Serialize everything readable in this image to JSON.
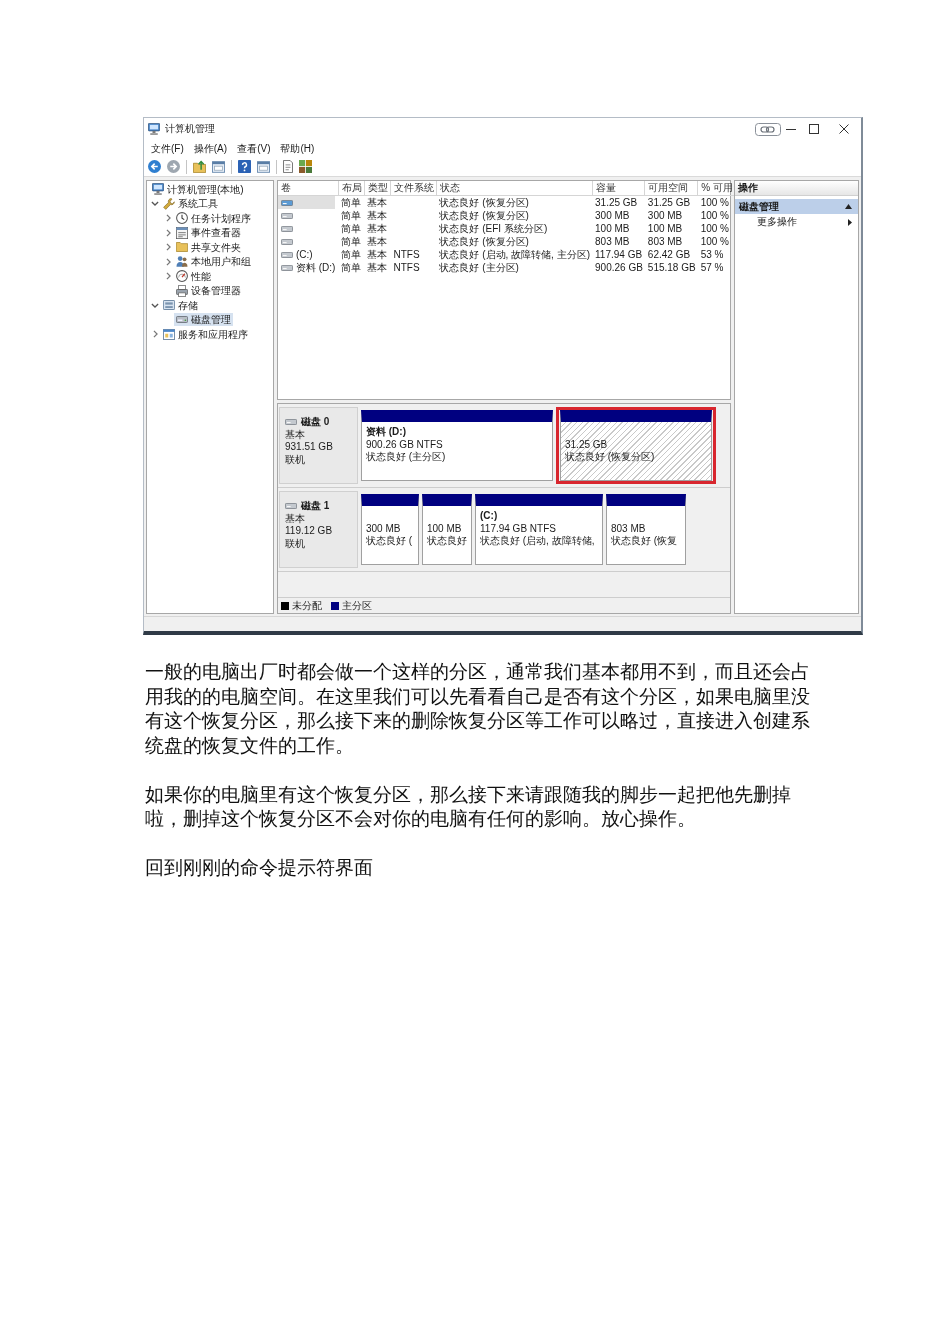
{
  "screenshot": {
    "window": {
      "title": "计算机管理"
    },
    "menu": [
      "文件(F)",
      "操作(A)",
      "查看(V)",
      "帮助(H)"
    ],
    "tree": [
      {
        "label": "计算机管理(本地)",
        "kind": "root",
        "selected": false,
        "children": [
          {
            "label": "系统工具",
            "kind": "branch",
            "expanded": true,
            "selected": false,
            "children": [
              {
                "label": "任务计划程序",
                "kind": "branch",
                "expanded": false,
                "selected": false
              },
              {
                "label": "事件查看器",
                "kind": "branch",
                "expanded": false,
                "selected": false
              },
              {
                "label": "共享文件夹",
                "kind": "branch",
                "expanded": false,
                "selected": false
              },
              {
                "label": "本地用户和组",
                "kind": "branch",
                "expanded": false,
                "selected": false
              },
              {
                "label": "性能",
                "kind": "branch",
                "expanded": false,
                "selected": false
              },
              {
                "label": "设备管理器",
                "kind": "leaf",
                "selected": false
              }
            ]
          },
          {
            "label": "存储",
            "kind": "branch",
            "expanded": true,
            "selected": false,
            "children": [
              {
                "label": "磁盘管理",
                "kind": "leaf",
                "selected": true
              }
            ]
          },
          {
            "label": "服务和应用程序",
            "kind": "branch",
            "expanded": false,
            "selected": false
          }
        ]
      }
    ],
    "volume_table": {
      "columns": [
        "卷",
        "布局",
        "类型",
        "文件系统",
        "状态",
        "容量",
        "可用空间",
        "% 可用"
      ],
      "rows": [
        {
          "selected": true,
          "layout": "简单",
          "type": "基本",
          "status": "状态良好 (恢复分区)",
          "capacity": "31.25 GB",
          "free_space": "31.25 GB",
          "percent_free": "100 %"
        },
        {
          "selected": false,
          "layout": "简单",
          "type": "基本",
          "status": "状态良好 (恢复分区)",
          "capacity": "300 MB",
          "free_space": "300 MB",
          "percent_free": "100 %"
        },
        {
          "selected": false,
          "layout": "简单",
          "type": "基本",
          "status": "状态良好 (EFI 系统分区)",
          "capacity": "100 MB",
          "free_space": "100 MB",
          "percent_free": "100 %"
        },
        {
          "selected": false,
          "layout": "简单",
          "type": "基本",
          "status": "状态良好 (恢复分区)",
          "capacity": "803 MB",
          "free_space": "803 MB",
          "percent_free": "100 %"
        },
        {
          "selected": false,
          "volume": "(C:)",
          "layout": "简单",
          "type": "基本",
          "file_system": "NTFS",
          "status": "状态良好 (启动, 故障转储, 主分区)",
          "capacity": "117.94 GB",
          "free_space": "62.42 GB",
          "percent_free": "53 %"
        },
        {
          "selected": false,
          "volume": "资料 (D:)",
          "layout": "简单",
          "type": "基本",
          "file_system": "NTFS",
          "status": "状态良好 (主分区)",
          "capacity": "900.26 GB",
          "free_space": "515.18 GB",
          "percent_free": "57 %"
        }
      ]
    },
    "disks": [
      {
        "name": "磁盘 0",
        "type": "基本",
        "size": "931.51 GB",
        "status": "联机",
        "partitions": [
          {
            "label": "资料 (D:)",
            "size": "900.26 GB NTFS",
            "status": "状态良好 (主分区)",
            "selected": false,
            "highlighted": false
          },
          {
            "size": "31.25 GB",
            "status": "状态良好 (恢复分区)",
            "selected": true,
            "highlighted": true
          }
        ]
      },
      {
        "name": "磁盘 1",
        "type": "基本",
        "size": "119.12 GB",
        "status": "联机",
        "partitions": [
          {
            "size": "300 MB",
            "status": "状态良好 (",
            "selected": false,
            "highlighted": false
          },
          {
            "size": "100 MB",
            "status": "状态良好",
            "selected": false,
            "highlighted": false
          },
          {
            "label": "(C:)",
            "size": "117.94 GB NTFS",
            "status": "状态良好 (启动, 故障转储,",
            "selected": false,
            "highlighted": false
          },
          {
            "size": "803 MB",
            "status": "状态良好 (恢复",
            "selected": false,
            "highlighted": false
          }
        ]
      }
    ],
    "legend": [
      {
        "label": "未分配",
        "color": "#000000"
      },
      {
        "label": "主分区",
        "color": "#000080"
      }
    ],
    "actions": {
      "title": "操作",
      "items": [
        {
          "label": "磁盘管理",
          "kind": "section"
        },
        {
          "label": "更多操作",
          "kind": "submenu"
        }
      ]
    }
  },
  "paragraphs": [
    "一般的电脑出厂时都会做一个这样的分区，通常我们基本都用不到，而且还会占用我的的电脑空间。在这里我们可以先看看自己是否有这个分区，如果电脑里没有这个恢复分区，那么接下来的删除恢复分区等工作可以略过，直接进入创建系统盘的恢复文件的工作。",
    "如果你的电脑里有这个恢复分区，那么接下来请跟随我的脚步一起把他先删掉啦，删掉这个恢复分区不会对你的电脑有任何的影响。放心操作。",
    "回到刚刚的命令提示符界面"
  ]
}
